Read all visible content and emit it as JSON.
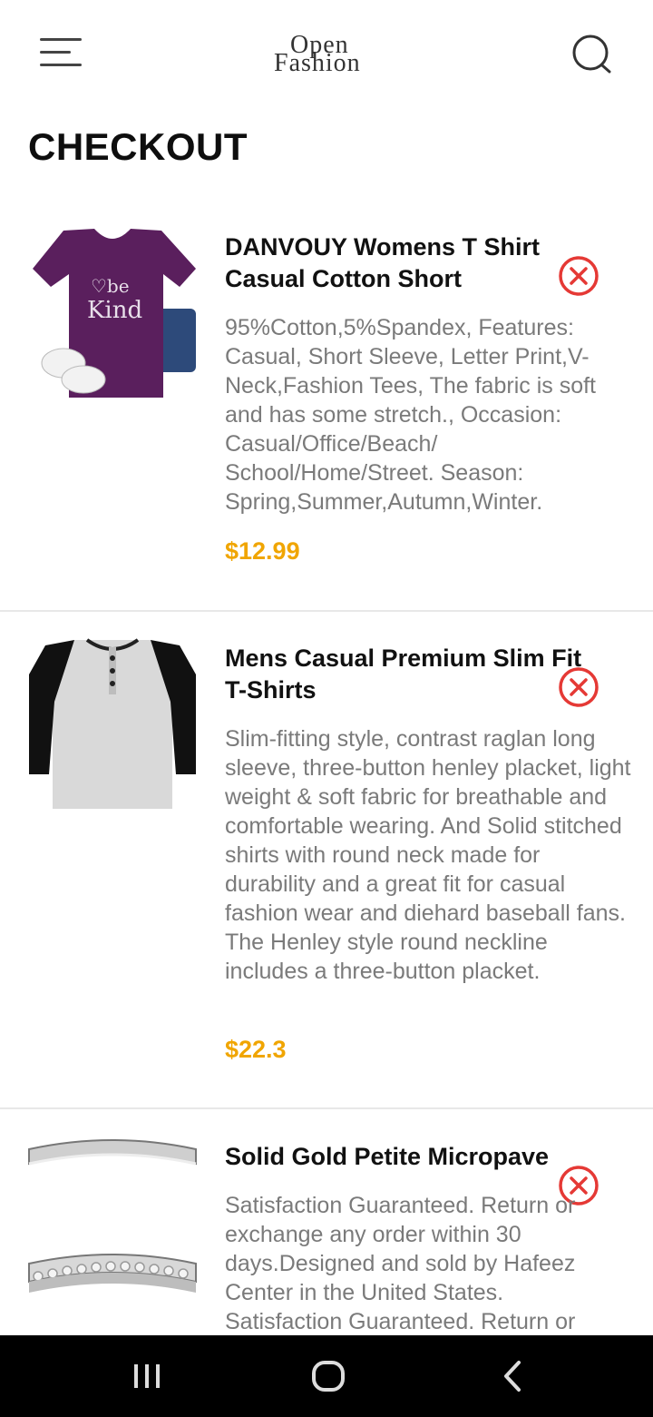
{
  "header": {
    "logo_line1": "Open",
    "logo_line2": "Fashion",
    "menu_icon": "hamburger-menu-icon",
    "search_icon": "search-icon"
  },
  "page": {
    "title": "CHECKOUT"
  },
  "colors": {
    "price": "#f0a500",
    "remove": "#e53935",
    "description": "#7a7a7a"
  },
  "items": [
    {
      "name": "DANVOUY Womens T Shirt Casual Cotton Short",
      "description": "95%Cotton,5%Spandex, Features: Casual, Short Sleeve, Letter Print,V-Neck,Fashion Tees, The fabric is soft and has some stretch., Occasion: Casual/Office/Beach/ School/Home/Street. Season: Spring,Summer,Autumn,Winter.",
      "price": "$12.99",
      "image_text": "♡be Kind"
    },
    {
      "name": "Mens Casual Premium Slim Fit T-Shirts",
      "description": "Slim-fitting style, contrast raglan long sleeve, three-button henley placket, light weight & soft fabric for breathable and comfortable wearing. And Solid stitched shirts with round neck made for durability and a great fit for casual fashion wear and diehard baseball fans. The Henley style round neckline includes a three-button placket.",
      "price": "$22.3"
    },
    {
      "name": "Solid Gold Petite Micropave",
      "description": "Satisfaction Guaranteed. Return or exchange any order within 30 days.Designed and sold by Hafeez Center in the United States. Satisfaction Guaranteed. Return or",
      "price": ""
    }
  ],
  "system_nav": {
    "recents_icon": "recent-apps-icon",
    "home_icon": "home-icon",
    "back_icon": "back-icon"
  }
}
